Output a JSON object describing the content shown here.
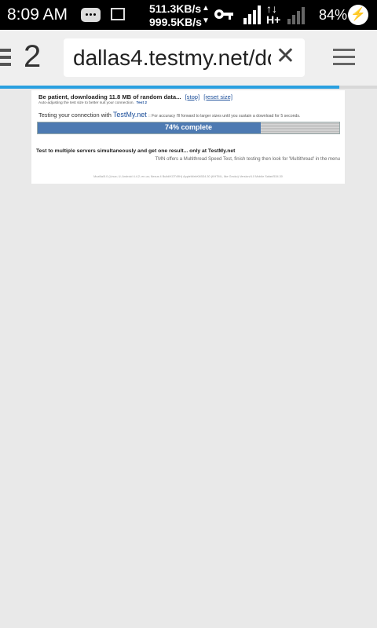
{
  "status_bar": {
    "time": "8:09 AM",
    "upload_speed": "511.3KB/s",
    "download_speed": "999.5KB/s",
    "network_type": "H+",
    "battery_percent": "84%",
    "icons": [
      "message-icon",
      "image-icon",
      "key-icon",
      "signal-icon",
      "data-arrows-icon",
      "signal-weak-icon",
      "battery-charging-icon"
    ]
  },
  "browser": {
    "tab_count": "2",
    "url": "dallas4.testmy.net/do",
    "page_load_progress": 0.9
  },
  "page": {
    "patience_text": "Be patient, downloading 11.8 MB of random data...",
    "stop_link": "[stop]",
    "reset_link": "[reset size]",
    "autoadjust_text": "Auto-adjusting the test size to better suit your connection.",
    "test_label": "Test 2",
    "testing_prefix": "Testing your connection with",
    "brand": "TestMy.net",
    "accuracy_hint": ":: For accuracy I'll forward to larger sizes until you sustain a download for 5 seconds.",
    "progress_percent": 74,
    "progress_label": "74% complete",
    "multi_server_text": "Test to multiple servers simultaneously and get one result... only at TestMy.net",
    "multithread_text": "TMN offers a Multithread Speed Test, finish testing then look for 'Multithread' in the menu",
    "user_agent": "Mozilla/5.0 (Linux; U; Android 4.4.2; en-us; Nexus 4 Build/KOT49H) AppleWebKit/534.30 (KHTML, like Gecko) Version/4.0 Mobile Safari/534.30"
  },
  "colors": {
    "status_bar_bg": "#000000",
    "toolbar_bg": "#efefef",
    "load_progress": "#2aa0e0",
    "progress_fill": "#4d7ab2",
    "link": "#1a4d99"
  }
}
